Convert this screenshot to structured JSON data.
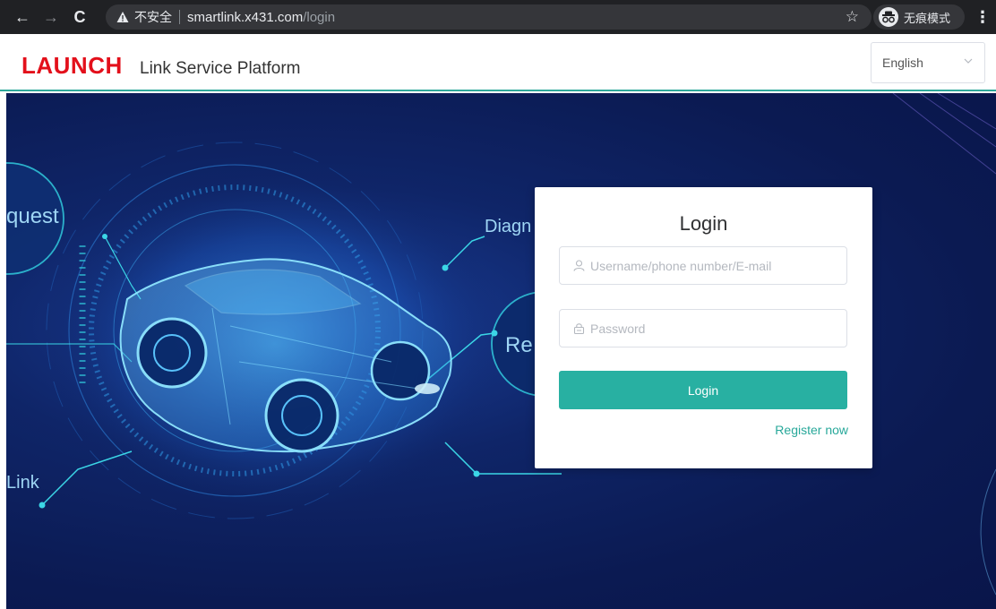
{
  "browser": {
    "insecure_label": "不安全",
    "url_host": "smartlink.x431.com",
    "url_path": "/login",
    "incognito_label": "无痕模式"
  },
  "header": {
    "brand": "LAUNCH",
    "subtitle": "Link Service Platform",
    "language": "English"
  },
  "hero": {
    "bubble_texts": [
      "quest",
      "Diagn",
      "Re",
      "Link"
    ]
  },
  "login": {
    "title": "Login",
    "username_placeholder": "Username/phone number/E-mail",
    "password_placeholder": "Password",
    "submit_label": "Login",
    "register_label": "Register now"
  },
  "colors": {
    "brand_red": "#e3101b",
    "accent_teal": "#28b0a2",
    "hero_blue": "#0b1a52"
  }
}
